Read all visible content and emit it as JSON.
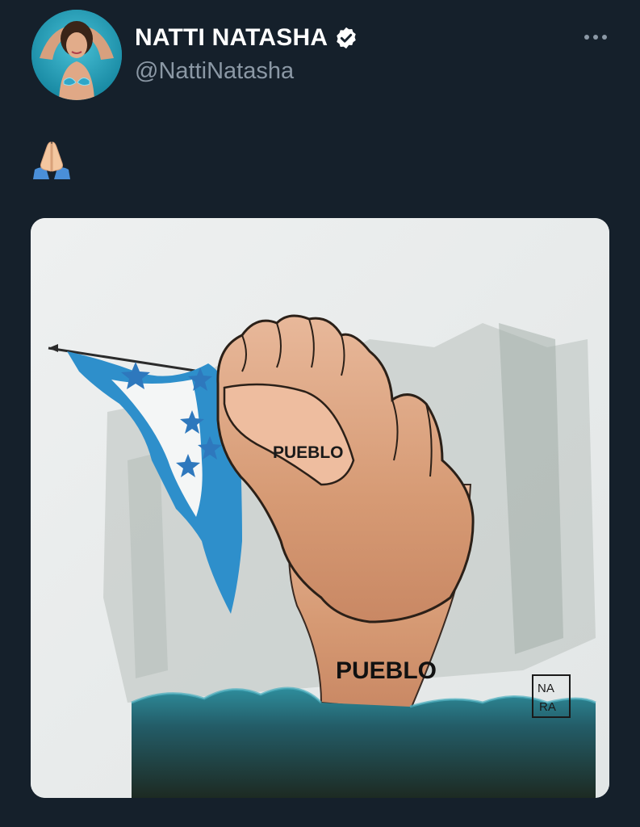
{
  "tweet": {
    "author": {
      "display_name": "NATTI NATASHA",
      "handle": "@NattiNatasha",
      "verified": true
    },
    "text": "🙏",
    "more_icon": "more-horizontal-icon",
    "media": {
      "type": "illustration",
      "labels": {
        "fist": "PUEBLO",
        "wrist": "PUEBLO",
        "signature_line1": "NA",
        "signature_line2": "RA"
      }
    }
  },
  "colors": {
    "background": "#15202b",
    "primary_text": "#ffffff",
    "secondary_text": "#8b98a5",
    "verified_badge": "#ffffff",
    "flag_blue": "#2d8ec9"
  }
}
